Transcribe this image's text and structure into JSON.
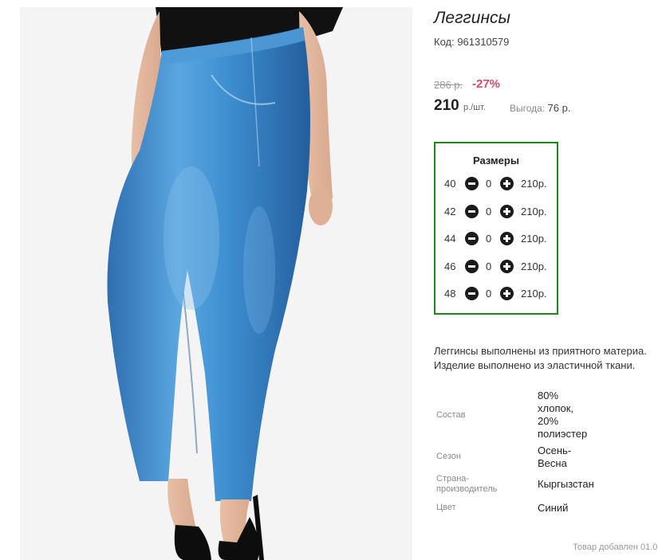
{
  "product": {
    "title": "Леггинсы",
    "code": "Код: 961310579",
    "old_price": "286 р.",
    "discount": "-27%",
    "price": "210",
    "price_unit": "р./шт.",
    "benefit_label": "Выгода:",
    "benefit_value": "76 р."
  },
  "sizes": {
    "title": "Размеры",
    "rows": [
      {
        "size": "40",
        "qty": "0",
        "price": "210р."
      },
      {
        "size": "42",
        "qty": "0",
        "price": "210р."
      },
      {
        "size": "44",
        "qty": "0",
        "price": "210р."
      },
      {
        "size": "46",
        "qty": "0",
        "price": "210р."
      },
      {
        "size": "48",
        "qty": "0",
        "price": "210р."
      }
    ]
  },
  "description": {
    "line1": "Леггинсы выполнены из приятного материа.",
    "line2": "Изделие выполнено из эластичной ткани."
  },
  "properties": {
    "composition_label": "Состав",
    "composition_value_1": "80%",
    "composition_value_2": "хлопок,",
    "composition_value_3": "20%",
    "composition_value_4": "полиэстер",
    "season_label": "Сезон",
    "season_value_1": "Осень-",
    "season_value_2": "Весна",
    "country_label_1": "Страна-",
    "country_label_2": "производитель",
    "country_value": "Кыргызстан",
    "color_label": "Цвет",
    "color_value": "Синий"
  },
  "footer": {
    "added": "Товар добавлен 01.0"
  },
  "colors": {
    "accent_discount": "#d64a6b",
    "sizes_border": "#188a18",
    "denim": "#3d8ed0"
  }
}
